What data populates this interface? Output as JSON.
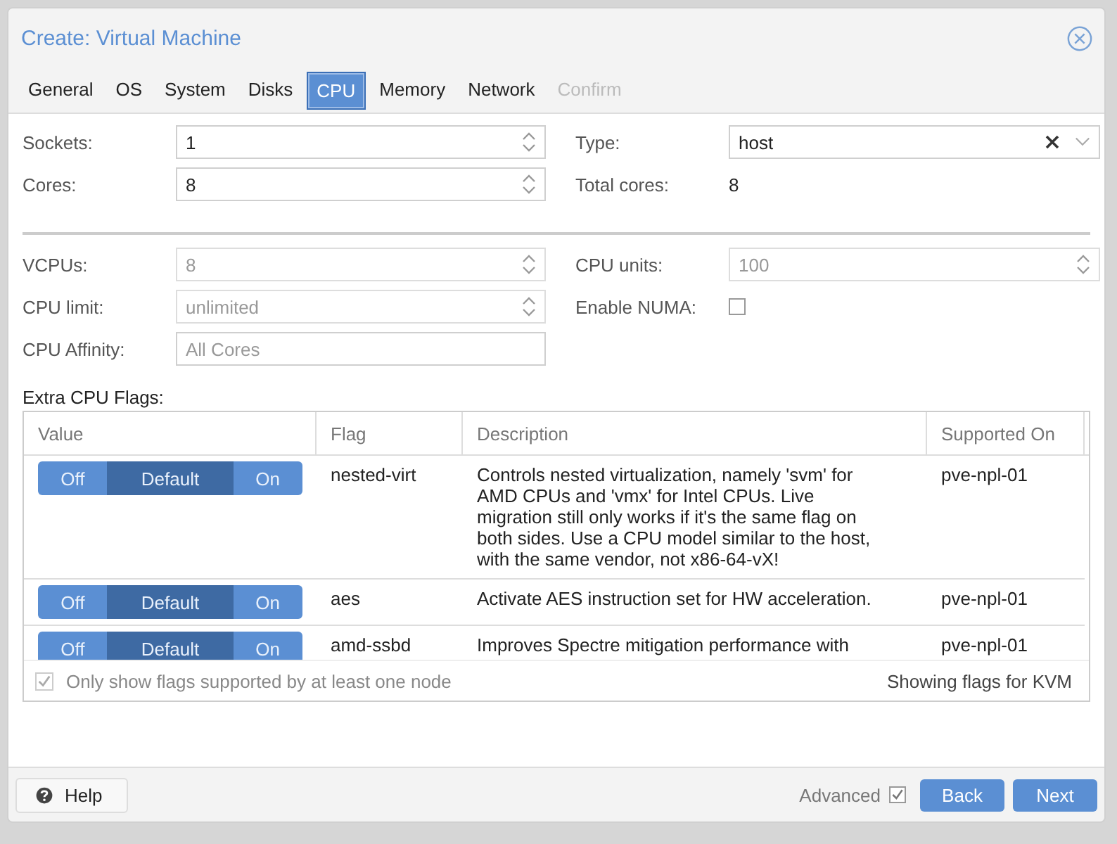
{
  "window": {
    "title": "Create: Virtual Machine"
  },
  "tabs": [
    {
      "label": "General",
      "selected": false,
      "disabled": false
    },
    {
      "label": "OS",
      "selected": false,
      "disabled": false
    },
    {
      "label": "System",
      "selected": false,
      "disabled": false
    },
    {
      "label": "Disks",
      "selected": false,
      "disabled": false
    },
    {
      "label": "CPU",
      "selected": true,
      "disabled": false
    },
    {
      "label": "Memory",
      "selected": false,
      "disabled": false
    },
    {
      "label": "Network",
      "selected": false,
      "disabled": false
    },
    {
      "label": "Confirm",
      "selected": false,
      "disabled": true
    }
  ],
  "basic": {
    "left": [
      {
        "kind": "spinner",
        "label": "Sockets:",
        "value": "1",
        "disabled": false
      },
      {
        "kind": "spinner",
        "label": "Cores:",
        "value": "8",
        "disabled": false
      }
    ],
    "right": [
      {
        "kind": "combo",
        "label": "Type:",
        "value": "host",
        "disabled": false
      },
      {
        "kind": "display",
        "label": "Total cores:",
        "value": "8"
      }
    ]
  },
  "advanced": {
    "left": [
      {
        "kind": "spinner",
        "label": "VCPUs:",
        "value": "8",
        "disabled": true
      },
      {
        "kind": "spinner",
        "label": "CPU limit:",
        "value": "unlimited",
        "disabled": true
      },
      {
        "kind": "text",
        "label": "CPU Affinity:",
        "placeholder": "All Cores",
        "disabled": false
      }
    ],
    "right": [
      {
        "kind": "spinner",
        "label": "CPU units:",
        "value": "100",
        "disabled": true
      },
      {
        "kind": "checkbox",
        "label": "Enable NUMA:",
        "checked": false
      }
    ]
  },
  "flags": {
    "label": "Extra CPU Flags:",
    "columns": [
      "Value",
      "Flag",
      "Description",
      "Supported On"
    ],
    "rows": [
      {
        "options": [
          {
            "label": "Off",
            "selected": false
          },
          {
            "label": "Default",
            "selected": true
          },
          {
            "label": "On",
            "selected": false
          }
        ],
        "flag": "nested-virt",
        "description": "Controls nested virtualization, namely 'svm' for AMD CPUs and 'vmx' for Intel CPUs. Live migration still only works if it's the same flag on both sides. Use a CPU model similar to the host, with the same vendor, not x86-64-vX!",
        "supported_on": "pve-npl-01"
      },
      {
        "options": [
          {
            "label": "Off",
            "selected": false
          },
          {
            "label": "Default",
            "selected": true
          },
          {
            "label": "On",
            "selected": false
          }
        ],
        "flag": "aes",
        "description": "Activate AES instruction set for HW acceleration.",
        "supported_on": "pve-npl-01"
      },
      {
        "options": [
          {
            "label": "Off",
            "selected": false
          },
          {
            "label": "Default",
            "selected": true
          },
          {
            "label": "On",
            "selected": false
          }
        ],
        "flag": "amd-ssbd",
        "description": "Improves Spectre mitigation performance with",
        "supported_on": "pve-npl-01"
      }
    ],
    "filter": {
      "label": "Only show flags supported by at least one node",
      "checked": true,
      "disabled": true
    },
    "info": "Showing flags for KVM"
  },
  "footer": {
    "help": "Help",
    "advanced": {
      "label": "Advanced",
      "checked": true
    },
    "buttons": [
      "Back",
      "Next"
    ]
  }
}
